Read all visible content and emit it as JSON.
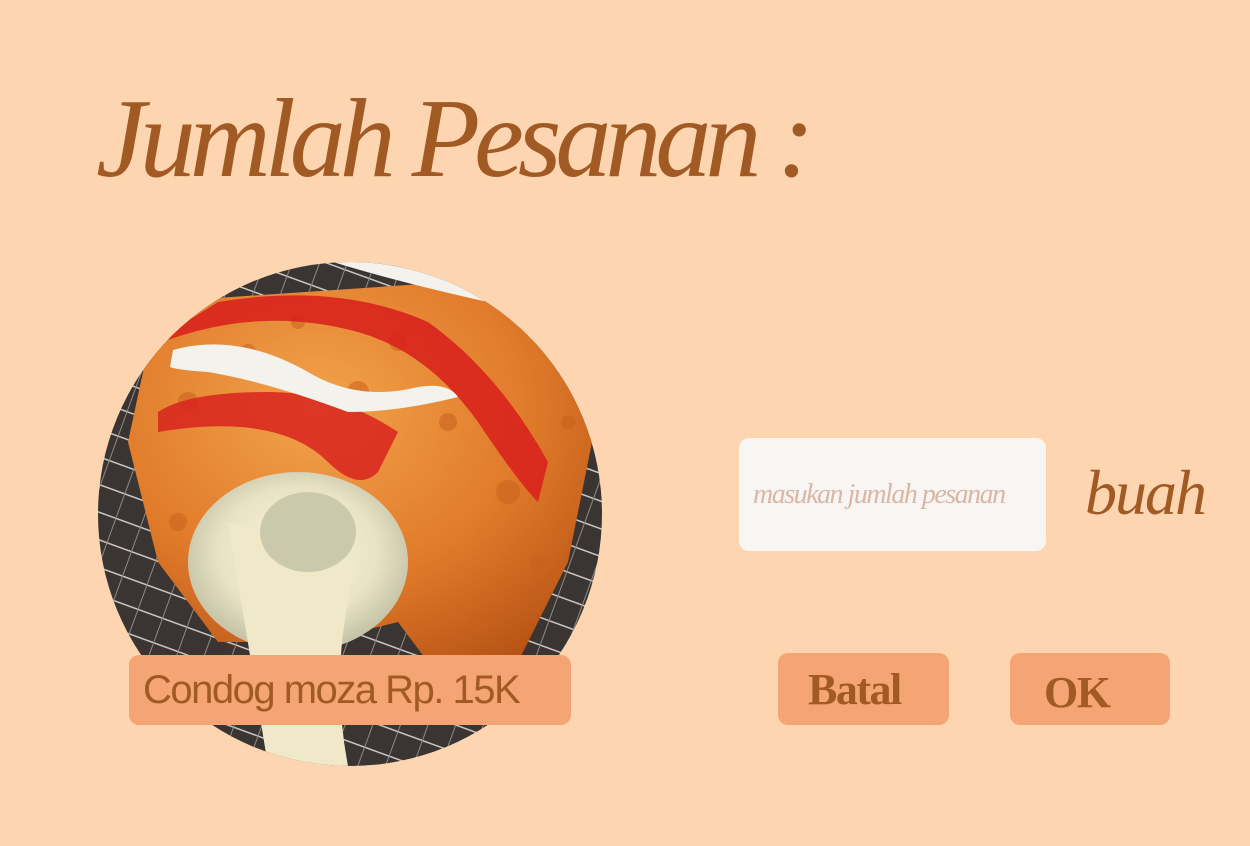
{
  "page": {
    "title": "Jumlah Pesanan :",
    "background_color": "#FDD5B0",
    "accent_color": "#F5A574",
    "text_color": "#A25A24"
  },
  "product": {
    "image_icon": "food-photo",
    "label": "Condog moza Rp. 15K"
  },
  "quantity": {
    "value": "",
    "placeholder": "masukan jumlah pesanan",
    "unit": "buah"
  },
  "actions": {
    "cancel_label": "Batal",
    "ok_label": "OK"
  }
}
